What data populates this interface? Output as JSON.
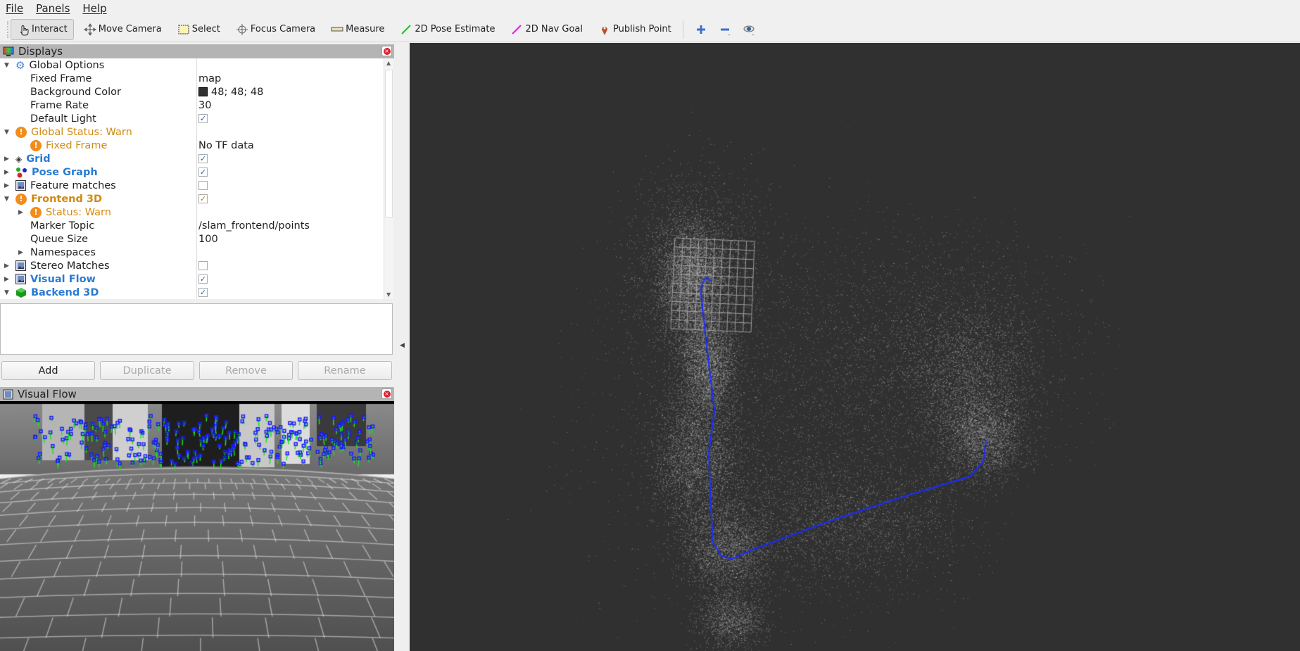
{
  "menu": [
    "File",
    "Panels",
    "Help"
  ],
  "toolbar": {
    "tools": [
      {
        "label": "Interact",
        "icon": "hand-pointer-icon",
        "active": true
      },
      {
        "label": "Move Camera",
        "icon": "move-camera-icon"
      },
      {
        "label": "Select",
        "icon": "select-box-icon"
      },
      {
        "label": "Focus Camera",
        "icon": "focus-camera-icon"
      },
      {
        "label": "Measure",
        "icon": "ruler-icon"
      },
      {
        "label": "2D Pose Estimate",
        "icon": "green-arrow-icon"
      },
      {
        "label": "2D Nav Goal",
        "icon": "magenta-arrow-icon"
      },
      {
        "label": "Publish Point",
        "icon": "map-pin-icon"
      }
    ]
  },
  "displays": {
    "title": "Displays",
    "rows": [
      {
        "name": "Global Options",
        "style": "",
        "indent": 0,
        "expand": "open",
        "icon": "gear"
      },
      {
        "name": "Fixed Frame",
        "style": "",
        "indent": 1,
        "value": "map"
      },
      {
        "name": "Background Color",
        "style": "",
        "indent": 1,
        "value": "48; 48; 48",
        "swatch": "#303030"
      },
      {
        "name": "Frame Rate",
        "style": "",
        "indent": 1,
        "value": "30"
      },
      {
        "name": "Default Light",
        "style": "",
        "indent": 1,
        "check": "on"
      },
      {
        "name": "Global Status: Warn",
        "style": "warn",
        "indent": 0,
        "expand": "open",
        "icon": "warn"
      },
      {
        "name": "Fixed Frame",
        "style": "warn",
        "indent": 1,
        "icon": "warn",
        "value": "No TF data"
      },
      {
        "name": "Grid",
        "style": "blue",
        "indent": 0,
        "expand": "closed",
        "icon": "grid",
        "check": "on"
      },
      {
        "name": "Pose Graph",
        "style": "blue",
        "indent": 0,
        "expand": "closed",
        "icon": "posegraph",
        "check": "on"
      },
      {
        "name": "Feature matches",
        "style": "",
        "indent": 0,
        "expand": "closed",
        "icon": "image",
        "check": "off"
      },
      {
        "name": "Frontend 3D",
        "style": "warnb",
        "indent": 0,
        "expand": "open",
        "icon": "warn",
        "check": "orange"
      },
      {
        "name": "Status: Warn",
        "style": "warn",
        "indent": 1,
        "expand": "closed",
        "icon": "warn"
      },
      {
        "name": "Marker Topic",
        "style": "",
        "indent": 1,
        "value": "/slam_frontend/points"
      },
      {
        "name": "Queue Size",
        "style": "",
        "indent": 1,
        "value": "100"
      },
      {
        "name": "Namespaces",
        "style": "",
        "indent": 1,
        "expand": "closed"
      },
      {
        "name": "Stereo Matches",
        "style": "",
        "indent": 0,
        "expand": "closed",
        "icon": "image",
        "check": "off"
      },
      {
        "name": "Visual Flow",
        "style": "blue",
        "indent": 0,
        "expand": "closed",
        "icon": "image",
        "check": "on"
      },
      {
        "name": "Backend 3D",
        "style": "blue",
        "indent": 0,
        "expand": "open",
        "icon": "cube",
        "check": "on"
      }
    ]
  },
  "buttons": {
    "add": "Add",
    "duplicate": "Duplicate",
    "remove": "Remove",
    "rename": "Rename"
  },
  "visual_flow": {
    "title": "Visual Flow"
  },
  "colors": {
    "view_bg": "#303030",
    "trajectory": "#1a2cff",
    "warn": "#f28c1c",
    "link_blue": "#2a7bd1"
  }
}
